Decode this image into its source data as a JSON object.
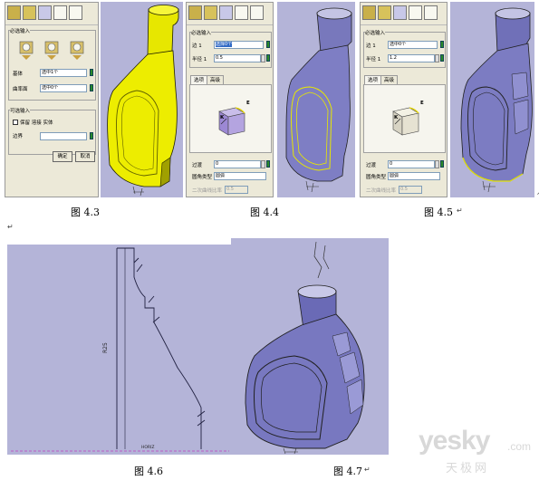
{
  "fig3": {
    "panel": {
      "group_required": "必选输入",
      "label_body": "基体",
      "value_body": "选中1个",
      "label_face": "曲率面",
      "value_face": "选中0个",
      "group_optional": "可选输入",
      "checkbox_label": "保留 溶接 实体",
      "label_edge": "边界",
      "ok_button": "确定",
      "cancel_button": "取消"
    },
    "caption": "图 4.3"
  },
  "fig4": {
    "panel": {
      "group_required": "必选输入",
      "label_edge": "边 1",
      "value_edge": "选择0个",
      "label_radius": "半径 1",
      "value_radius": "0.5",
      "tab_options": "选项",
      "tab_advanced": "高级",
      "axis_e": "E",
      "axis_k": "K",
      "label_transition": "过渡",
      "value_transition": "0",
      "label_type": "圆角类型",
      "value_type": "圆弧",
      "label_ratio": "二次曲线比率",
      "value_ratio": "0.5"
    },
    "caption": "图 4.4"
  },
  "fig5": {
    "panel": {
      "group_required": "必选输入",
      "label_edge": "边 1",
      "value_edge": "选中0个",
      "label_radius": "半径 1",
      "value_radius": "1.2",
      "tab_options": "选项",
      "tab_advanced": "高级",
      "axis_e": "E",
      "axis_k": "K",
      "label_transition": "过渡",
      "value_transition": "0",
      "label_type": "圆角类型",
      "value_type": "圆弧",
      "label_ratio": "二次曲线比率",
      "value_ratio": "0.5"
    },
    "caption": "图 4.5"
  },
  "fig6": {
    "dim_label": "R25",
    "bottom_label": "HORIZ",
    "caption": "图 4.6"
  },
  "fig7": {
    "caption": "图 4.7",
    "watermark_main": "yesky",
    "watermark_sub": "天极网",
    "watermark_domain": ".com"
  },
  "return_mark": "↵",
  "colors": {
    "viewport_bg": "#b4b4d8",
    "model_yellow": "#f0f000",
    "model_blue": "#8888cc",
    "panel_bg": "#ece9d8"
  }
}
